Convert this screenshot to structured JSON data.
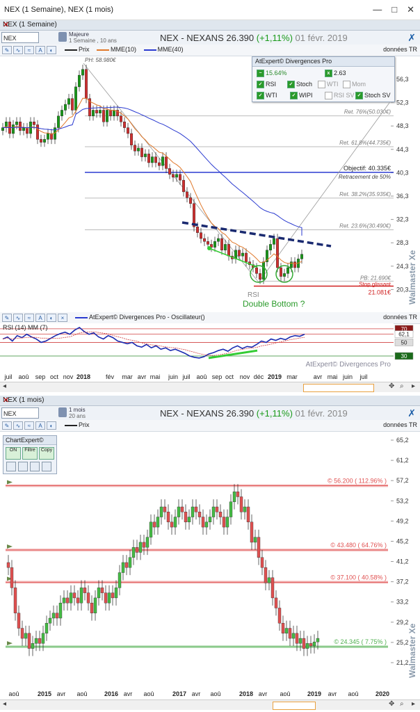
{
  "window": {
    "title": "NEX (1 Semaine), NEX (1 mois)"
  },
  "top": {
    "tab": "NEX (1 Semaine)",
    "symbol": "NEX",
    "period_line1": "Majeure",
    "period_line2": "1 Semaine , 10 ans",
    "title_name": "NEX - NEXANS",
    "title_price": "26.390",
    "title_change": "(+1,11%)",
    "title_date": "01 févr. 2019",
    "data_label": "données TR",
    "legend": [
      {
        "label": "Prix",
        "color": "#222222"
      },
      {
        "label": "MME(10)",
        "color": "#e0782a"
      },
      {
        "label": "MME(40)",
        "color": "#2a3ad0"
      }
    ],
    "panel": {
      "title": "AtExpert© Divergences Pro",
      "pct": "15.64%",
      "val": "2.63",
      "row2": [
        {
          "label": "RSI",
          "on": true
        },
        {
          "label": "Stoch",
          "on": true
        },
        {
          "label": "WTI",
          "on": false
        },
        {
          "label": "Mom",
          "on": false
        }
      ],
      "row3": [
        {
          "label": "WTI",
          "on": true
        },
        {
          "label": "WIPI",
          "on": true
        },
        {
          "label": "RSI SV",
          "on": false
        },
        {
          "label": "Stoch SV",
          "on": true
        }
      ]
    },
    "annotations": {
      "ph": "PH: 58.980€",
      "fib76": "Ret. 76%(50.030€)",
      "fib618": "Ret. 61.8%(44.735€)",
      "objectif": "Objectif: 40.335€",
      "retr50": "Retracement de 50%",
      "fib382": "Ret. 38.2%(35.935€)",
      "fib236": "Ret. 23.6%(30.490€)",
      "pb": "PB: 21.690€",
      "stop": "Stop glissant",
      "stop_val": "21.081€",
      "rsi": "RSI",
      "double_bottom": "Double Bottom ?"
    },
    "price_axis": [
      "56,3",
      "52,3",
      "48,3",
      "44,3",
      "40,3",
      "36,3",
      "32,3",
      "28,3",
      "24,3",
      "20,3"
    ],
    "watermark": "Walmaster Xe",
    "osc": {
      "title": "AtExpert© Divergences Pro - Oscillateur()",
      "rsi_label": "RSI (14) MM (7)",
      "watermark": "AtExpert© Divergences Pro",
      "axis": [
        "70",
        "62,1",
        "50",
        "30"
      ],
      "data_label": "données TR"
    },
    "time_axis": [
      "juil",
      "aoû",
      "sep",
      "oct",
      "nov",
      "2018",
      "fév",
      "mar",
      "avr",
      "mai",
      "juin",
      "juil",
      "aoû",
      "sep",
      "oct",
      "nov",
      "déc",
      "2019",
      "mar",
      "avr",
      "mai",
      "juin",
      "juil"
    ]
  },
  "bottom": {
    "tab": "NEX (1 mois)",
    "symbol": "NEX",
    "period_line1": "1 mois",
    "period_line2": "20 ans",
    "title_name": "NEX - NEXANS",
    "title_price": "26.390",
    "title_change": "(+1,11%)",
    "title_date": "01 févr. 2019",
    "data_label": "données TR",
    "legend": [
      {
        "label": "Prix",
        "color": "#222222"
      }
    ],
    "chartexpert": {
      "title": "ChartExpert©",
      "b1": "ON",
      "b2": "Filtre",
      "b3": "Copy"
    },
    "levels": [
      {
        "label": "© 56.200 ( 112.96% )",
        "color": "#e05050",
        "value": 56.2
      },
      {
        "label": "© 43.480 ( 64.76% )",
        "color": "#e05050",
        "value": 43.48
      },
      {
        "label": "© 37.100 ( 40.58% )",
        "color": "#e05050",
        "value": 37.1
      },
      {
        "label": "© 24.345 ( 7.75% )",
        "color": "#50b050",
        "value": 24.345
      }
    ],
    "price_axis": [
      "65,2",
      "61,2",
      "57,2",
      "53,2",
      "49,2",
      "45,2",
      "41,2",
      "37,2",
      "33,2",
      "29,2",
      "25,2",
      "21,2"
    ],
    "watermark": "Walmaster Xe",
    "time_axis": [
      "aoû",
      "2015",
      "avr",
      "aoû",
      "2016",
      "avr",
      "aoû",
      "2017",
      "avr",
      "aoû",
      "2018",
      "avr",
      "aoû",
      "2019",
      "avr",
      "aoû",
      "2020"
    ]
  }
}
